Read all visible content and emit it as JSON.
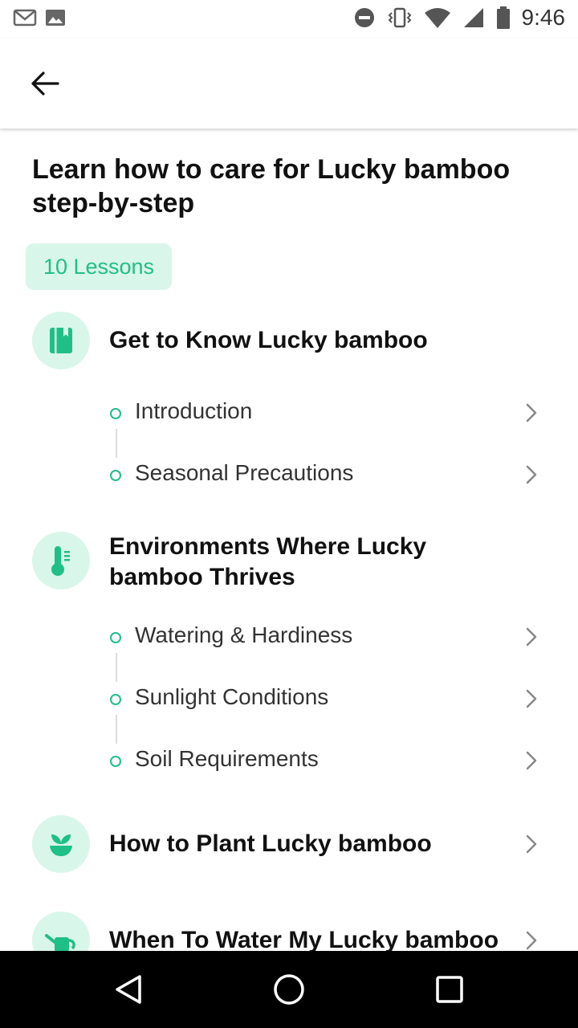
{
  "status_bar": {
    "time": "9:46",
    "left_icons": [
      "gmail-icon",
      "image-icon"
    ],
    "right_icons": [
      "dnd-icon",
      "vibrate-icon",
      "wifi-icon",
      "cell-signal-icon",
      "battery-icon"
    ]
  },
  "header": {
    "back_icon": "arrow-left-icon"
  },
  "page": {
    "title": "Learn how to care for Lucky bamboo step-by-step",
    "lessons_badge": "10 Lessons"
  },
  "sections": [
    {
      "title": "Get to Know Lucky bamboo",
      "icon": "book-icon",
      "lessons": [
        "Introduction",
        "Seasonal Precautions"
      ]
    },
    {
      "title": "Environments Where Lucky bamboo Thrives",
      "icon": "thermometer-icon",
      "lessons": [
        "Watering & Hardiness",
        "Sunlight Conditions",
        "Soil Requirements"
      ]
    },
    {
      "title": "How to Plant Lucky bamboo",
      "icon": "sprout-pot-icon",
      "lessons": []
    },
    {
      "title": "When To Water My Lucky bamboo",
      "icon": "watering-can-icon",
      "lessons": []
    }
  ],
  "colors": {
    "accent": "#1fbf88",
    "accent_light": "#d9f6ea",
    "text": "#111111",
    "secondary_text": "#333333"
  },
  "nav_bar": {
    "icons": [
      "back-triangle-icon",
      "home-circle-icon",
      "recents-square-icon"
    ]
  }
}
